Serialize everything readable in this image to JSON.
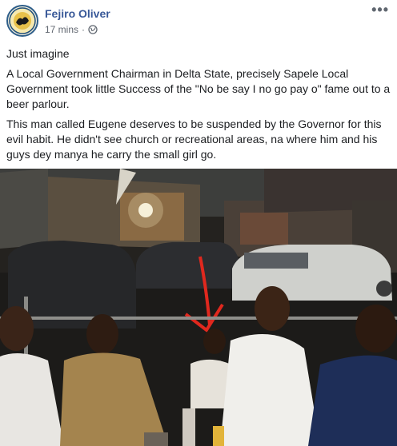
{
  "post": {
    "author": "Fejiro Oliver",
    "time": "17 mins",
    "separator": "·",
    "privacy_icon": "globe-icon",
    "more_icon": "more-options-icon",
    "more_glyph": "•••",
    "paragraphs": [
      "Just imagine",
      "A Local Government Chairman in Delta State, precisely Sapele Local Government took little Success of the \"No be say I no go pay o\" fame out to a beer parlour.",
      "This man called Eugene deserves to be suspended by the Governor for this evil habit. He didn't see church or recreational areas, na where him and his guys dey manya he carry the small girl go."
    ]
  },
  "photo": {
    "description_icon": "red-arrow-annotation",
    "colors": {
      "arrow": "#e0281e",
      "accent_link": "#385898"
    }
  }
}
